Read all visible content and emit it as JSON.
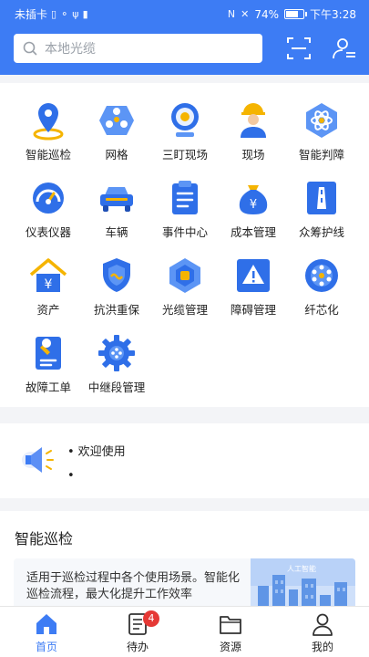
{
  "status_bar": {
    "carrier": "未插卡",
    "battery": "74%",
    "battery_level": 0.74,
    "time": "下午3:28"
  },
  "header": {
    "search_placeholder": "本地光缆",
    "bg_color": "#3d7cf4"
  },
  "grid": {
    "items": [
      {
        "label": "智能巡检",
        "icon": "location-pin-icon"
      },
      {
        "label": "网格",
        "icon": "grid-network-icon"
      },
      {
        "label": "三盯现场",
        "icon": "webcam-icon"
      },
      {
        "label": "现场",
        "icon": "worker-icon"
      },
      {
        "label": "智能判障",
        "icon": "atom-icon"
      },
      {
        "label": "仪表仪器",
        "icon": "gauge-icon"
      },
      {
        "label": "车辆",
        "icon": "car-icon"
      },
      {
        "label": "事件中心",
        "icon": "clipboard-icon"
      },
      {
        "label": "成本管理",
        "icon": "money-bag-icon"
      },
      {
        "label": "众筹护线",
        "icon": "road-icon"
      },
      {
        "label": "资产",
        "icon": "house-yuan-icon"
      },
      {
        "label": "抗洪重保",
        "icon": "shield-icon"
      },
      {
        "label": "光缆管理",
        "icon": "cable-hex-icon"
      },
      {
        "label": "障碍管理",
        "icon": "warning-icon"
      },
      {
        "label": "纤芯化",
        "icon": "fiber-core-icon"
      },
      {
        "label": "故障工单",
        "icon": "work-order-icon"
      },
      {
        "label": "中继段管理",
        "icon": "gear-icon"
      }
    ]
  },
  "notice": {
    "items": [
      "欢迎使用",
      ""
    ]
  },
  "patrol": {
    "title": "智能巡检",
    "description": "适用于巡检过程中各个使用场景。智能化巡检流程，最大化提升工作效率",
    "image_caption": "人工智能"
  },
  "tabbar": {
    "tabs": [
      {
        "label": "首页",
        "icon": "home-icon"
      },
      {
        "label": "待办",
        "icon": "todo-list-icon"
      },
      {
        "label": "资源",
        "icon": "folder-icon"
      },
      {
        "label": "我的",
        "icon": "person-icon"
      }
    ],
    "todo_badge": "4"
  }
}
